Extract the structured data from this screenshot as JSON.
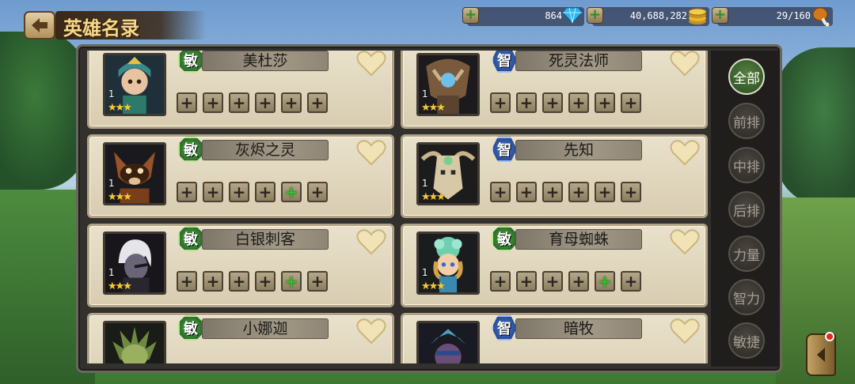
{
  "header": {
    "title": "英雄名录",
    "back_icon": "back-arrow-icon"
  },
  "resources": [
    {
      "name": "gems",
      "value": "864",
      "icon": "diamond-icon",
      "color": "#2fb6f0"
    },
    {
      "name": "gold",
      "value": "40,688,282",
      "icon": "gold-coins-icon",
      "color": "#e8b62c"
    },
    {
      "name": "stamina",
      "value": "29/160",
      "icon": "drumstick-icon",
      "color": "#d2781c"
    }
  ],
  "heroes": [
    {
      "name": "美杜莎",
      "class_label": "敏",
      "class_type": "agi",
      "level": "1",
      "stars": 3,
      "gear": [
        "plain",
        "plain",
        "plain",
        "plain",
        "plain",
        "plain"
      ]
    },
    {
      "name": "死灵法师",
      "class_label": "智",
      "class_type": "int",
      "level": "1",
      "stars": 3,
      "gear": [
        "plain",
        "plain",
        "plain",
        "plain",
        "plain",
        "plain"
      ]
    },
    {
      "name": "灰烬之灵",
      "class_label": "敏",
      "class_type": "agi",
      "level": "1",
      "stars": 3,
      "gear": [
        "plain",
        "plain",
        "plain",
        "plain",
        "green",
        "plain"
      ]
    },
    {
      "name": "先知",
      "class_label": "智",
      "class_type": "int",
      "level": "1",
      "stars": 3,
      "gear": [
        "plain",
        "plain",
        "plain",
        "plain",
        "plain",
        "plain"
      ]
    },
    {
      "name": "白银刺客",
      "class_label": "敏",
      "class_type": "agi",
      "level": "1",
      "stars": 3,
      "gear": [
        "plain",
        "plain",
        "plain",
        "plain",
        "green",
        "plain"
      ]
    },
    {
      "name": "育母蜘蛛",
      "class_label": "敏",
      "class_type": "agi",
      "level": "1",
      "stars": 3,
      "gear": [
        "plain",
        "plain",
        "plain",
        "plain",
        "green",
        "plain"
      ]
    },
    {
      "name": "小娜迦",
      "class_label": "敏",
      "class_type": "agi",
      "level": "",
      "stars": 0,
      "gear": []
    },
    {
      "name": "暗牧",
      "class_label": "智",
      "class_type": "int",
      "level": "",
      "stars": 0,
      "gear": []
    }
  ],
  "filters": [
    {
      "label": "全部",
      "active": true
    },
    {
      "label": "前排",
      "active": false
    },
    {
      "label": "中排",
      "active": false
    },
    {
      "label": "后排",
      "active": false
    },
    {
      "label": "力量",
      "active": false
    },
    {
      "label": "智力",
      "active": false
    },
    {
      "label": "敏捷",
      "active": false
    }
  ],
  "colors": {
    "accent": "#5b8a3c",
    "gear_plus_green": "#31c12a",
    "notification": "#e3261f"
  }
}
